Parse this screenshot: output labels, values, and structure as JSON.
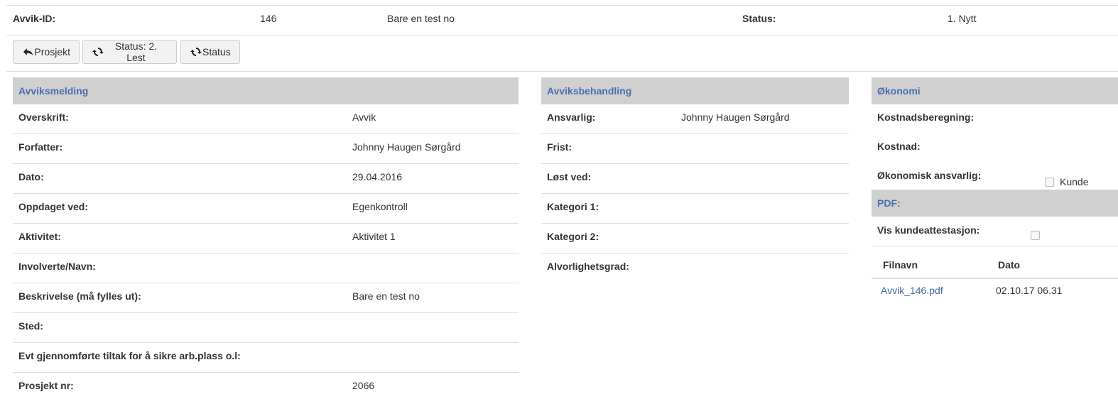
{
  "header": {
    "id_label": "Avvik-ID:",
    "id_value": "146",
    "title_value": "Bare en test no",
    "status_label": "Status:",
    "status_value": "1. Nytt"
  },
  "toolbar": {
    "project_label": "Prosjekt",
    "status_read_label": "Status: 2. Lest",
    "status_label": "Status"
  },
  "avviksmelding": {
    "title": "Avviksmelding",
    "rows": [
      {
        "label": "Overskrift:",
        "value": "Avvik"
      },
      {
        "label": "Forfatter:",
        "value": "Johnny Haugen Sørgård"
      },
      {
        "label": "Dato:",
        "value": "29.04.2016"
      },
      {
        "label": "Oppdaget ved:",
        "value": "Egenkontroll"
      },
      {
        "label": "Aktivitet:",
        "value": "Aktivitet 1"
      },
      {
        "label": "Involverte/Navn:",
        "value": ""
      },
      {
        "label": "Beskrivelse (må fylles ut):",
        "value": "Bare en test no"
      },
      {
        "label": "Sted:",
        "value": ""
      },
      {
        "label": "Evt gjennomførte tiltak for å sikre arb.plass o.l:",
        "value": ""
      },
      {
        "label": "Prosjekt nr:",
        "value": "2066"
      }
    ]
  },
  "avviksbehandling": {
    "title": "Avviksbehandling",
    "rows": [
      {
        "label": "Ansvarlig:",
        "value": "Johnny Haugen Sørgård"
      },
      {
        "label": "Frist:",
        "value": ""
      },
      {
        "label": "Løst ved:",
        "value": ""
      },
      {
        "label": "Kategori 1:",
        "value": ""
      },
      {
        "label": "Kategori 2:",
        "value": ""
      },
      {
        "label": "Alvorlighetsgrad:",
        "value": ""
      }
    ]
  },
  "okonomi": {
    "title": "Økonomi",
    "cost_calc_label": "Kostnadsberegning:",
    "cost_label": "Kostnad:",
    "responsible_label": "Økonomisk ansvarlig:",
    "customer_label": "Kunde"
  },
  "pdf": {
    "title": "PDF:",
    "show_attest_label": "Vis kundeattestasjon:",
    "col_filename": "Filnavn",
    "col_date": "Dato",
    "files": [
      {
        "name": "Avvik_146.pdf",
        "date": "02.10.17 06.31"
      }
    ]
  },
  "icons": {
    "back": "reply-arrow-icon",
    "refresh": "refresh-icon"
  },
  "colors": {
    "panel_header_bg": "#d0d0d0",
    "panel_header_text": "#4a6fae",
    "link": "#3a6ea5"
  }
}
